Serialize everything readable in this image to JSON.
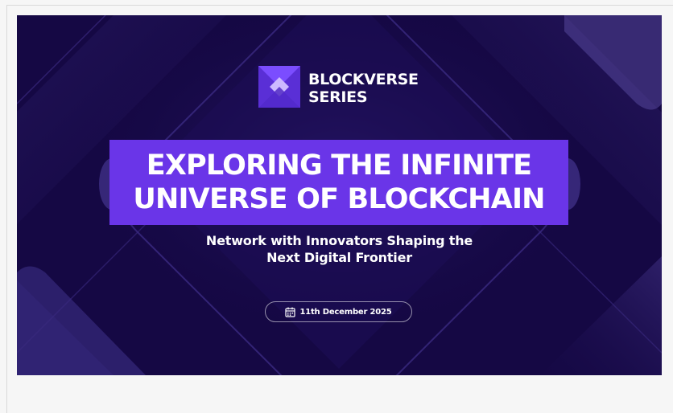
{
  "banner": {
    "brand": {
      "line1": "BLOCKVERSE",
      "line2": "SERIES",
      "logo_icon": "blockverse-logo-icon"
    },
    "title": {
      "line1": "EXPLORING THE INFINITE",
      "line2": "UNIVERSE OF BLOCKCHAIN"
    },
    "subtitle": {
      "line1": "Network with Innovators Shaping the",
      "line2": "Next Digital Frontier"
    },
    "event_date": {
      "icon": "calendar-icon",
      "text": "11th December 2025"
    }
  },
  "colors": {
    "background": "#150844",
    "accent": "#6a35e8",
    "logo": "#7b4dff",
    "text": "#ffffff"
  }
}
